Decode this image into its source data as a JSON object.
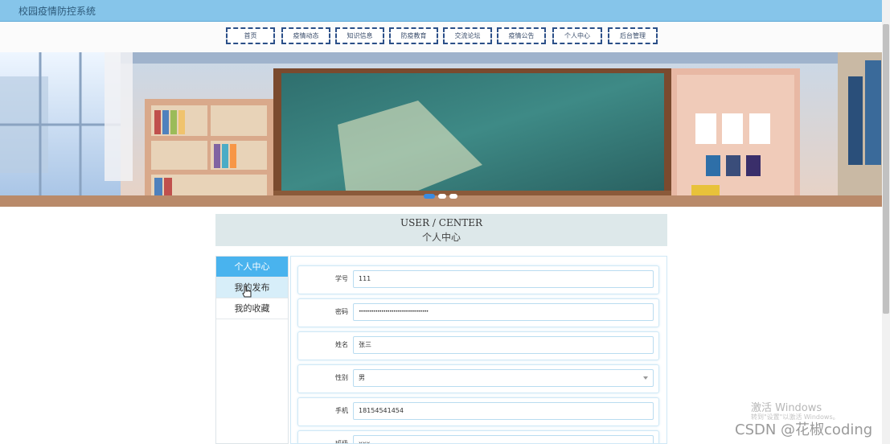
{
  "app": {
    "title": "校园疫情防控系统"
  },
  "nav": {
    "items": [
      {
        "label": "首页"
      },
      {
        "label": "疫情动态"
      },
      {
        "label": "知识信息"
      },
      {
        "label": "防疫教育"
      },
      {
        "label": "交流论坛"
      },
      {
        "label": "疫情公告"
      },
      {
        "label": "个人中心"
      },
      {
        "label": "后台管理"
      }
    ]
  },
  "banner": {
    "slides": 3,
    "active_slide": 1
  },
  "section": {
    "en_title": "USER / CENTER",
    "cn_title": "个人中心"
  },
  "side_menu": {
    "items": [
      {
        "label": "个人中心"
      },
      {
        "label": "我的发布"
      },
      {
        "label": "我的收藏"
      }
    ],
    "active": "个人中心",
    "hover": "我的发布"
  },
  "form": {
    "fields": [
      {
        "label": "学号",
        "value": "111"
      },
      {
        "label": "密码",
        "value": "••••••••••••••••••••••••••••••••••"
      },
      {
        "label": "姓名",
        "value": "张三"
      },
      {
        "label": "性别",
        "value": "男"
      },
      {
        "label": "手机",
        "value": "18154541454"
      },
      {
        "label": "班级",
        "value": "xxx"
      }
    ]
  },
  "overlay": {
    "activate_title": "激活 Windows",
    "activate_sub": "转到\"设置\"以激活 Windows。",
    "csdn": "CSDN @花椒coding"
  },
  "colors": {
    "topbar": "#86c5ea",
    "accent": "#49b3ee",
    "nav_border": "#2b4f88",
    "section_bg": "#dde8ea"
  }
}
